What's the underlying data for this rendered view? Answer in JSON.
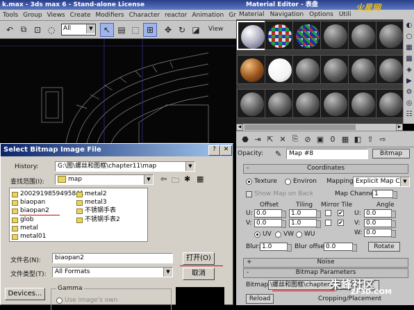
{
  "max": {
    "title": "k.max - 3ds max 6 - Stand-alone License",
    "menu": [
      "Tools",
      "Group",
      "Views",
      "Create",
      "Modifiers",
      "Character",
      "reactor",
      "Animation",
      "Grap"
    ],
    "selection_filter": "All",
    "viewport_label": "View"
  },
  "material_editor": {
    "title": "Material Editor - 表盘",
    "menu": [
      "Material",
      "Navigation",
      "Options",
      "Utili"
    ],
    "opacity_label": "Opacity:",
    "map_name": "Map #8",
    "map_type_button": "Bitmap",
    "coordinates": {
      "rollout_title": "Coordinates",
      "texture_label": "Texture",
      "environ_label": "Environ",
      "mapping_label": "Mapping:",
      "mapping_value": "Explicit Map Channel",
      "show_map_label": "Show Map on Back",
      "map_channel_label": "Map Channel:",
      "map_channel_value": "1",
      "offset_label": "Offset",
      "tiling_label": "Tiling",
      "mirror_tile_label": "Mirror Tile",
      "angle_label": "Angle",
      "u_label": "U:",
      "v_label": "V:",
      "w_label": "W:",
      "u_offset": "0.0",
      "u_tiling": "1.0",
      "v_offset": "0.0",
      "v_tiling": "1.0",
      "u_angle": "0.0",
      "v_angle": "0.0",
      "w_angle": "0.0",
      "uv_label": "UV",
      "vw_label": "VW",
      "wu_label": "WU",
      "blur_label": "Blur:",
      "blur_value": "1.0",
      "blur_offset_label": "Blur offset:",
      "blur_offset_value": "0.0",
      "rotate_label": "Rotate"
    },
    "noise_rollout": "Noise",
    "bitmap_rollout": "Bitmap Parameters",
    "bitmap_label": "Bitmap:",
    "bitmap_path": "\\螺丝和图框\\chapter11\\map",
    "reload_label": "Reload",
    "cropping_label": "Cropping/Placement",
    "slots_count": 18
  },
  "dialog": {
    "title": "Select Bitmap Image File",
    "history_label": "History:",
    "history_value": "G:\\图\\螺丝和图框\\chapter11\\map",
    "lookin_label": "查找范围(I):",
    "lookin_value": "map",
    "files": [
      {
        "name": "2002919859495841"
      },
      {
        "name": "biaopan"
      },
      {
        "name": "biaopan2"
      },
      {
        "name": "glob"
      },
      {
        "name": "metal"
      },
      {
        "name": "metal01"
      },
      {
        "name": "metal2"
      },
      {
        "name": "metal3"
      },
      {
        "name": "不锈钢手表"
      },
      {
        "name": "不锈钢手表2"
      }
    ],
    "filename_label": "文件名(N):",
    "filename_value": "biaopan2",
    "filetype_label": "文件类型(T):",
    "filetype_value": "All Formats",
    "open_button": "打开(O)",
    "cancel_button": "取消",
    "devices_button": "Devices...",
    "gamma_label": "Gamma",
    "gamma_option": "Use image's own"
  },
  "watermark": {
    "top": "火星网",
    "bottom": "朱峰社区",
    "bottom_sub": "ZF3D.COM"
  }
}
